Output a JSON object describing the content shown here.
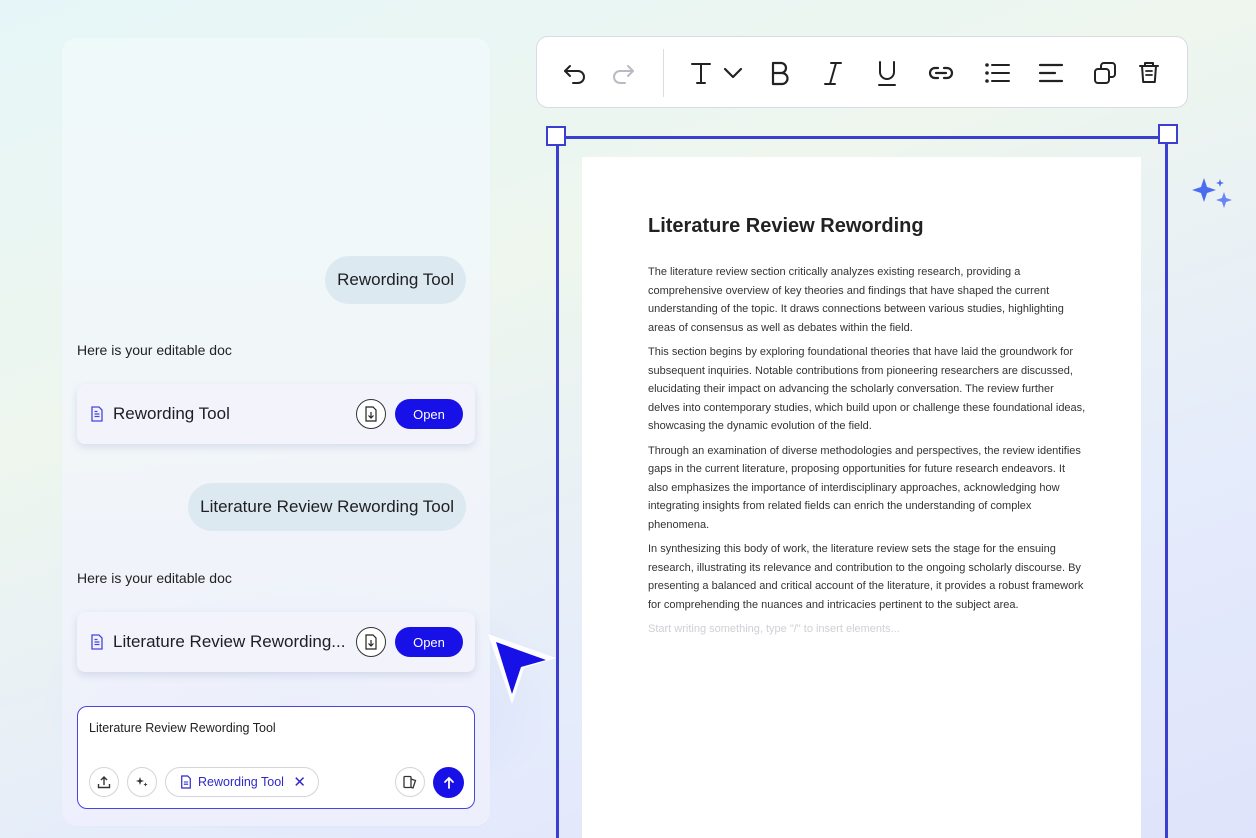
{
  "chat": {
    "messages": [
      {
        "role": "user",
        "text": "Rewording Tool"
      },
      {
        "role": "assistant",
        "caption": "Here is your editable doc",
        "doc_title": "Rewording Tool",
        "open_label": "Open"
      },
      {
        "role": "user",
        "text": "Literature Review Rewording Tool"
      },
      {
        "role": "assistant",
        "caption": "Here is your editable doc",
        "doc_title": "Literature Review Rewording...",
        "open_label": "Open"
      }
    ],
    "input": {
      "value": "Literature Review Rewording Tool",
      "tag_label": "Rewording Tool"
    }
  },
  "toolbar": {
    "icons": [
      "undo-icon",
      "redo-icon",
      "text-style-icon",
      "chevron-down-icon",
      "bold-icon",
      "italic-icon",
      "underline-icon",
      "link-icon",
      "bullet-list-icon",
      "align-left-icon",
      "duplicate-icon",
      "delete-icon"
    ]
  },
  "document": {
    "title": "Literature Review Rewording",
    "paragraphs": [
      "The literature review section critically analyzes existing research, providing a comprehensive overview of key theories and findings that have shaped the current understanding of the topic. It draws connections between various studies, highlighting areas of consensus as well as debates within the field.",
      "This section begins by exploring foundational theories that have laid the groundwork for subsequent inquiries. Notable contributions from pioneering researchers are discussed, elucidating their impact on advancing the scholarly conversation. The review further delves into contemporary studies, which build upon or challenge these foundational ideas, showcasing the dynamic evolution of the field.",
      "Through an examination of diverse methodologies and perspectives, the review identifies gaps in the current literature, proposing opportunities for future research endeavors. It also emphasizes the importance of interdisciplinary approaches, acknowledging how integrating insights from related fields can enrich the understanding of complex phenomena.",
      "In synthesizing this body of work, the literature review sets the stage for the ensuing research, illustrating its relevance and contribution to the ongoing scholarly discourse. By presenting a balanced and critical account of the literature, it provides a robust framework for comprehending the nuances and intricacies pertinent to the subject area."
    ],
    "placeholder": "Start writing something, type \"/\" to insert elements..."
  },
  "colors": {
    "accent": "#1711e8",
    "frame": "#3a3fd0",
    "sparkle": "#4a6cf0"
  }
}
